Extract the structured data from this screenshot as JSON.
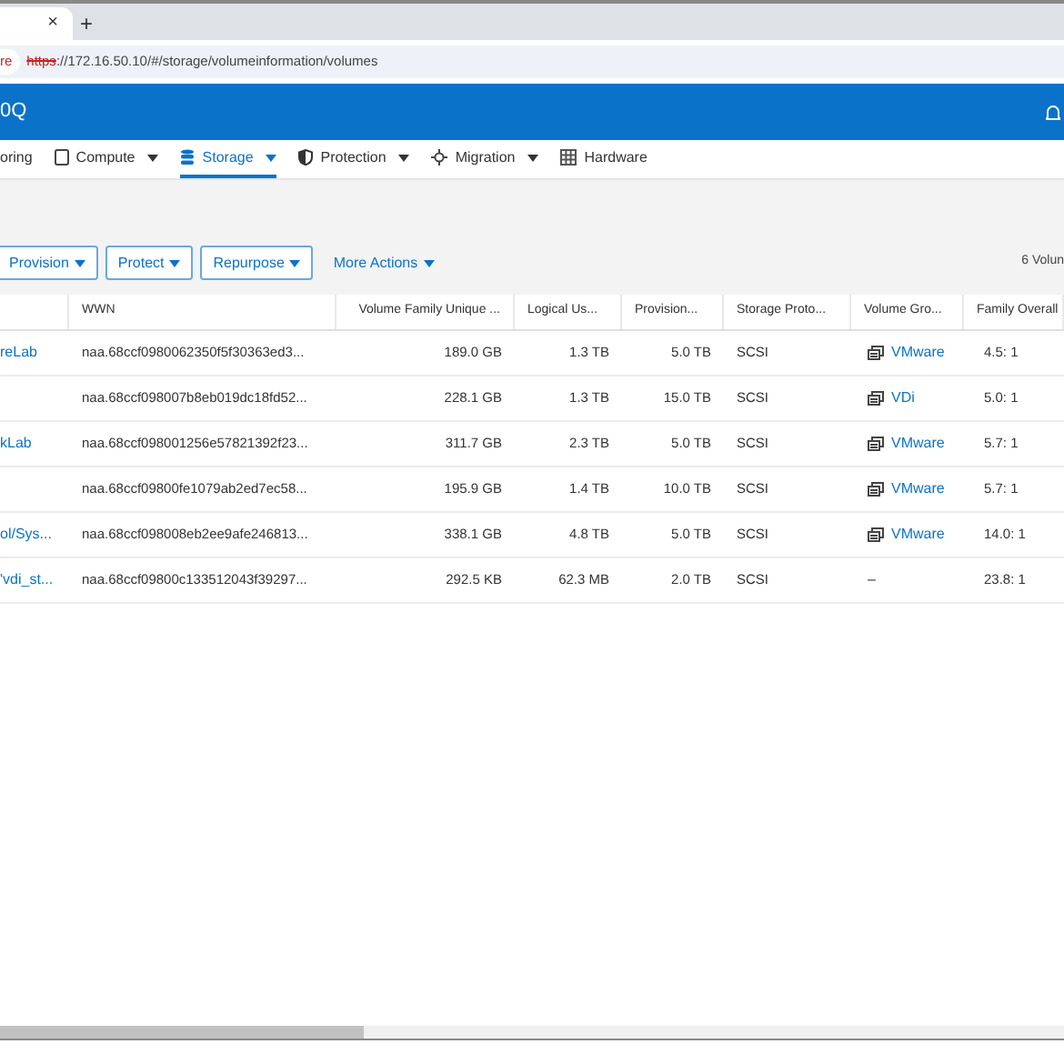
{
  "browser": {
    "tab_close": "×",
    "new_tab": "+",
    "security_badge": "re",
    "url_scheme": "https",
    "url_rest": "://172.16.50.10/#/storage/volumeinformation/volumes"
  },
  "header": {
    "title": "0Q"
  },
  "nav": [
    {
      "label": "oring",
      "kind": "none",
      "dropdown": false,
      "selected": false
    },
    {
      "label": "Compute",
      "kind": "compute",
      "dropdown": true,
      "selected": false
    },
    {
      "label": "Storage",
      "kind": "storage",
      "dropdown": true,
      "selected": true
    },
    {
      "label": "Protection",
      "kind": "shield",
      "dropdown": true,
      "selected": false
    },
    {
      "label": "Migration",
      "kind": "migration",
      "dropdown": true,
      "selected": false
    },
    {
      "label": "Hardware",
      "kind": "hardware",
      "dropdown": false,
      "selected": false
    }
  ],
  "actions": [
    {
      "label": "Provision",
      "kind": "outlined"
    },
    {
      "label": "Protect",
      "kind": "outlined"
    },
    {
      "label": "Repurpose",
      "kind": "outlined"
    },
    {
      "label": "More Actions",
      "kind": "link"
    }
  ],
  "count": "6 Volun",
  "table": {
    "columns": [
      "",
      "WWN",
      "Volume Family Unique ...",
      "Logical Us...",
      "Provision...",
      "Storage Proto...",
      "Volume Gro...",
      "Family Overall"
    ],
    "rows": [
      {
        "name": "reLab",
        "wwn": "naa.68ccf0980062350f5f30363ed3...",
        "unique": "189.0 GB",
        "logical": "1.3 TB",
        "provisioned": "5.0 TB",
        "protocol": "SCSI",
        "group": "VMware",
        "group_linked": true,
        "family": "4.5: 1"
      },
      {
        "name": "",
        "wwn": "naa.68ccf098007b8eb019dc18fd52...",
        "unique": "228.1 GB",
        "logical": "1.3 TB",
        "provisioned": "15.0 TB",
        "protocol": "SCSI",
        "group": "VDi",
        "group_linked": true,
        "family": "5.0: 1"
      },
      {
        "name": "kLab",
        "wwn": "naa.68ccf098001256e57821392f23...",
        "unique": "311.7 GB",
        "logical": "2.3 TB",
        "provisioned": "5.0 TB",
        "protocol": "SCSI",
        "group": "VMware",
        "group_linked": true,
        "family": "5.7: 1"
      },
      {
        "name": "",
        "wwn": "naa.68ccf09800fe1079ab2ed7ec58...",
        "unique": "195.9 GB",
        "logical": "1.4 TB",
        "provisioned": "10.0 TB",
        "protocol": "SCSI",
        "group": "VMware",
        "group_linked": true,
        "family": "5.7: 1"
      },
      {
        "name": "ol/Sys...",
        "wwn": "naa.68ccf098008eb2ee9afe246813...",
        "unique": "338.1 GB",
        "logical": "4.8 TB",
        "provisioned": "5.0 TB",
        "protocol": "SCSI",
        "group": "VMware",
        "group_linked": true,
        "family": "14.0: 1"
      },
      {
        "name": "'vdi_st...",
        "wwn": "naa.68ccf09800c133512043f39297...",
        "unique": "292.5 KB",
        "logical": "62.3 MB",
        "provisioned": "2.0 TB",
        "protocol": "SCSI",
        "group": "–",
        "group_linked": false,
        "family": "23.8: 1"
      }
    ]
  }
}
